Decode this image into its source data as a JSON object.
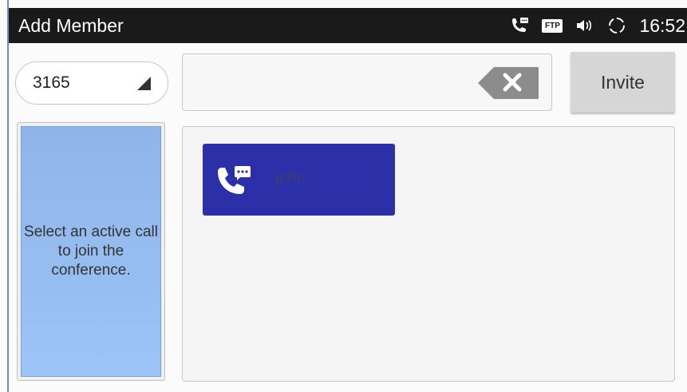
{
  "window": {
    "title": "Add Member"
  },
  "statusbar": {
    "ftp_badge": "FTP",
    "time": "16:52",
    "icons": [
      "call-message-icon",
      "ftp-icon",
      "volume-icon",
      "sync-icon"
    ]
  },
  "account": {
    "selected": "3165"
  },
  "number_input": {
    "value": "",
    "placeholder": ""
  },
  "invite_button": {
    "label": "Invite"
  },
  "active_call_panel": {
    "message": "Select an active call to join the conference."
  },
  "calls": [
    {
      "name": "john",
      "icon": "call-message-icon"
    }
  ],
  "colors": {
    "statusbar": "#1a1a1a",
    "accent_border": "#5f8fc8",
    "active_panel": "#9cc4f5",
    "call_card": "#2b2fa8",
    "invite_button": "#d6d6d6"
  }
}
